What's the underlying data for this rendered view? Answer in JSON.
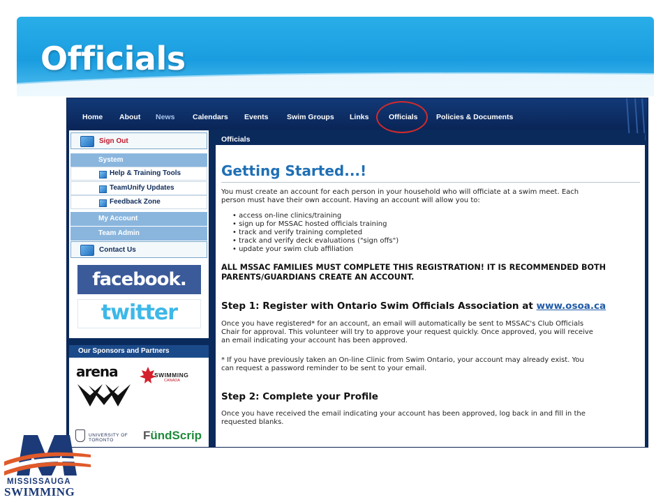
{
  "slide": {
    "title": "Officials"
  },
  "nav": {
    "items": [
      "Home",
      "About",
      "News",
      "Calendars",
      "Events",
      "Swim Groups",
      "Links",
      "Officials",
      "Policies & Documents"
    ]
  },
  "sidebar": {
    "sign_out": "Sign Out",
    "system_header": "System",
    "system_items": [
      "Help & Training Tools",
      "TeamUnify Updates",
      "Feedback Zone"
    ],
    "my_account": "My Account",
    "team_admin": "Team Admin",
    "contact_us": "Contact Us",
    "facebook": "facebook.",
    "twitter": "twitter",
    "sponsors_header": "Our Sponsors and Partners",
    "sponsors": {
      "arena": "arena",
      "swimming_canada": "SWIMMING",
      "swimming_canada_sub": "CANADA",
      "uoft_line1": "UNIVERSITY OF",
      "uoft_line2": "TORONTO",
      "fundscrip_a": "F",
      "fundscrip_b": "ündScrip"
    }
  },
  "content": {
    "header": "Officials",
    "heading": "Getting Started...!",
    "intro_1": "You must create an account for each person in your household who will officiate at a swim meet.  Each",
    "intro_2": "person must have their own account. Having an account will allow you to:",
    "bullets": [
      "access on-line clinics/training",
      "sign up for MSSAC hosted officials training",
      "track and verify training completed",
      "track and verify deck evaluations (\"sign offs\")",
      "update your swim club affiliation"
    ],
    "notice_1": "ALL MSSAC FAMILIES MUST COMPLETE THIS REGISTRATION! IT IS RECOMMENDED BOTH",
    "notice_2": "PARENTS/GUARDIANS CREATE AN ACCOUNT.",
    "step1_title": "Step 1: Register with Ontario Swim Officials Association at ",
    "step1_link": "www.osoa.ca",
    "step1_p1": "Once you have registered* for an account, an email will automatically be sent to MSSAC's Club Officials",
    "step1_p2": "Chair for approval.  This volunteer will try to approve your request quickly. Once approved, you will receive",
    "step1_p3": "an email indicating your account has been approved.",
    "step1_note1": "* If you have previously taken an On-line Clinic from Swim Ontario, your account may already exist. You",
    "step1_note2": "can request a password reminder to be sent to your email.",
    "step2_title": "Step 2: Complete your Profile",
    "step2_p1": "Once you have received the email indicating your account has been approved, log back in and fill in the",
    "step2_p2": "requested blanks."
  },
  "logo": {
    "line1": "MISSISSAUGA",
    "line2": "SWIMMING"
  },
  "colors": {
    "banner": "#1a9de0",
    "nav": "#0b2a5c",
    "heading": "#1f6fb5",
    "highlight_circle": "#d42a2a"
  }
}
